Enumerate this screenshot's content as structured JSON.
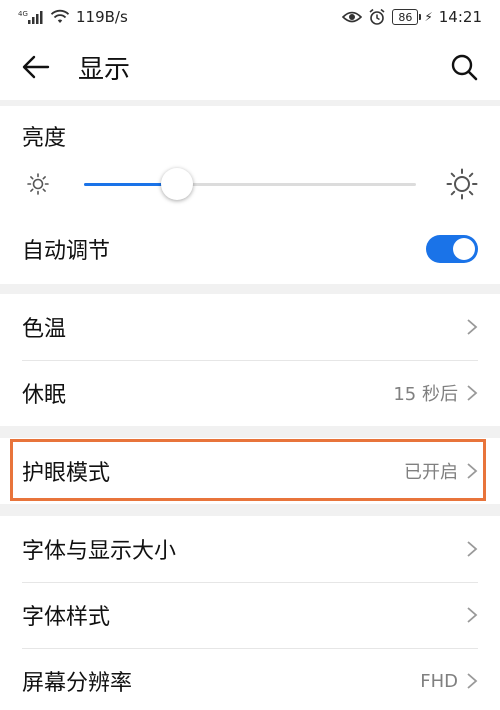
{
  "status_bar": {
    "network": "4G",
    "speed": "119B/s",
    "battery": "86",
    "time": "14:21"
  },
  "header": {
    "title": "显示"
  },
  "brightness": {
    "label": "亮度",
    "level_percent": 28,
    "auto_label": "自动调节",
    "auto_on": true
  },
  "group1": [
    {
      "label": "色温",
      "value": ""
    },
    {
      "label": "休眠",
      "value": "15 秒后"
    }
  ],
  "eye_comfort": {
    "label": "护眼模式",
    "value": "已开启"
  },
  "group3": [
    {
      "label": "字体与显示大小",
      "value": ""
    },
    {
      "label": "字体样式",
      "value": ""
    },
    {
      "label": "屏幕分辨率",
      "value": "FHD"
    }
  ],
  "colors": {
    "accent": "#1a73e8",
    "highlight": "#e8743b"
  }
}
